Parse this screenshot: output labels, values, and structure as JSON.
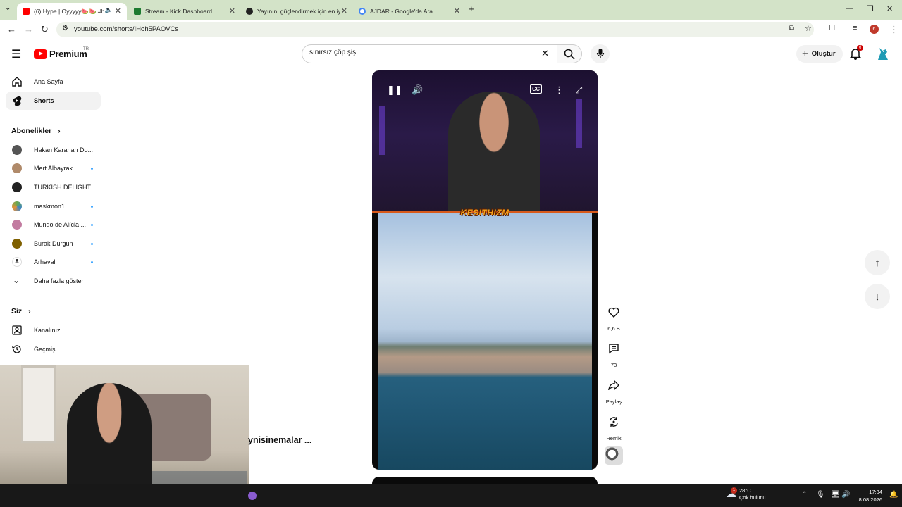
{
  "browser": {
    "tabs": [
      {
        "title": "(6) Hype | Oyyyyy🍉🍉 #hy",
        "active": true,
        "favicon_color": "#ff0000"
      },
      {
        "title": "Stream - Kick Dashboard",
        "active": false,
        "favicon_color": "#1c7a2f"
      },
      {
        "title": "Yayınını güçlendirmek için en iy",
        "active": false,
        "favicon_color": "#222222"
      },
      {
        "title": "AJDAR - Google'da Ara",
        "active": false,
        "favicon_color": "#4285f4"
      }
    ],
    "url": "youtube.com/shorts/IHoh5PAOVCs",
    "profile_initial": "6"
  },
  "header": {
    "logo_text": "Premium",
    "logo_region": "TR",
    "search_value": "sınırsız çöp şiş",
    "create_label": "Oluştur",
    "notification_count": "6"
  },
  "sidebar": {
    "main": [
      {
        "label": "Ana Sayfa",
        "icon": "home-icon"
      },
      {
        "label": "Shorts",
        "icon": "shorts-icon",
        "active": true
      }
    ],
    "subscriptions_title": "Abonelikler",
    "subscriptions": [
      {
        "label": "Hakan Karahan Do...",
        "dot": false,
        "color": "#555555"
      },
      {
        "label": "Mert Albayrak",
        "dot": true,
        "color": "#b08a6a"
      },
      {
        "label": "TURKISH DELIGHT ...",
        "dot": false,
        "color": "#222222"
      },
      {
        "label": "maskmon1",
        "dot": true,
        "color": "#6aa84f"
      },
      {
        "label": "Mundo de Alícia ...",
        "dot": true,
        "color": "#c27ba0"
      },
      {
        "label": "Burak Durgun",
        "dot": true,
        "color": "#7f6000"
      },
      {
        "label": "Arhaval",
        "dot": true,
        "color": "#ffffff"
      }
    ],
    "show_more": "Daha fazla göster",
    "you_title": "Siz",
    "you": [
      {
        "label": "Kanalınız",
        "icon": "channel-icon"
      },
      {
        "label": "Geçmiş",
        "icon": "history-icon"
      }
    ]
  },
  "short": {
    "overlay_brand": "KESITHIZM",
    "channel_title_partial": "ynisinemalar ...",
    "actions": {
      "likes": "6,6 B",
      "comments": "73",
      "share": "Paylaş",
      "remix": "Remix"
    }
  },
  "taskbar": {
    "weather_temp": "28°C",
    "weather_desc": "Çok bulutlu",
    "weather_alert": "1",
    "time": "17:34",
    "date": "8.08.2026"
  }
}
